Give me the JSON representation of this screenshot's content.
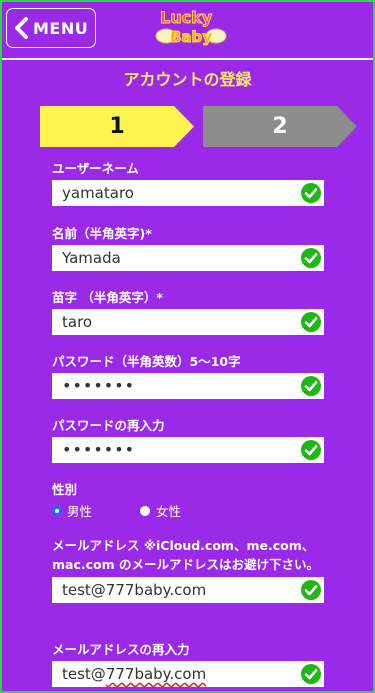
{
  "header": {
    "menu_label": "MENU",
    "logo_alt": "Lucky Baby"
  },
  "page": {
    "title": "アカウントの登録"
  },
  "steps": [
    {
      "number": "1",
      "active": true,
      "color": "#fff34d"
    },
    {
      "number": "2",
      "active": false,
      "color": "#8c8c8c"
    }
  ],
  "fields": {
    "username": {
      "label": "ユーザーネーム",
      "value": "yamataro"
    },
    "first_name": {
      "label": "名前（半角英字)*",
      "value": "Yamada"
    },
    "last_name": {
      "label": "苗字 （半角英字）*",
      "value": "taro"
    },
    "password": {
      "label": "パスワード（半角英数）5〜10字",
      "value": "•••••••"
    },
    "password_confirm": {
      "label": "パスワードの再入力",
      "value": "•••••••"
    },
    "gender": {
      "label": "性別",
      "options": [
        "男性",
        "女性"
      ],
      "selected": "男性"
    },
    "email": {
      "label": "メールアドレス ※iCloud.com、me.com、mac.com のメールアドレスはお避け下さい。",
      "value": "test@777baby.com"
    },
    "email_confirm": {
      "label": "メールアドレスの再入力",
      "value_prefix": "test@",
      "value_suffix": "777baby.com"
    }
  },
  "colors": {
    "background": "#9a2ae8",
    "title": "#ffe96a",
    "check": "#1fb714",
    "frame": "#2dd34a"
  },
  "icons": {
    "back": "chevron-left-icon",
    "valid": "check-circle-icon"
  }
}
